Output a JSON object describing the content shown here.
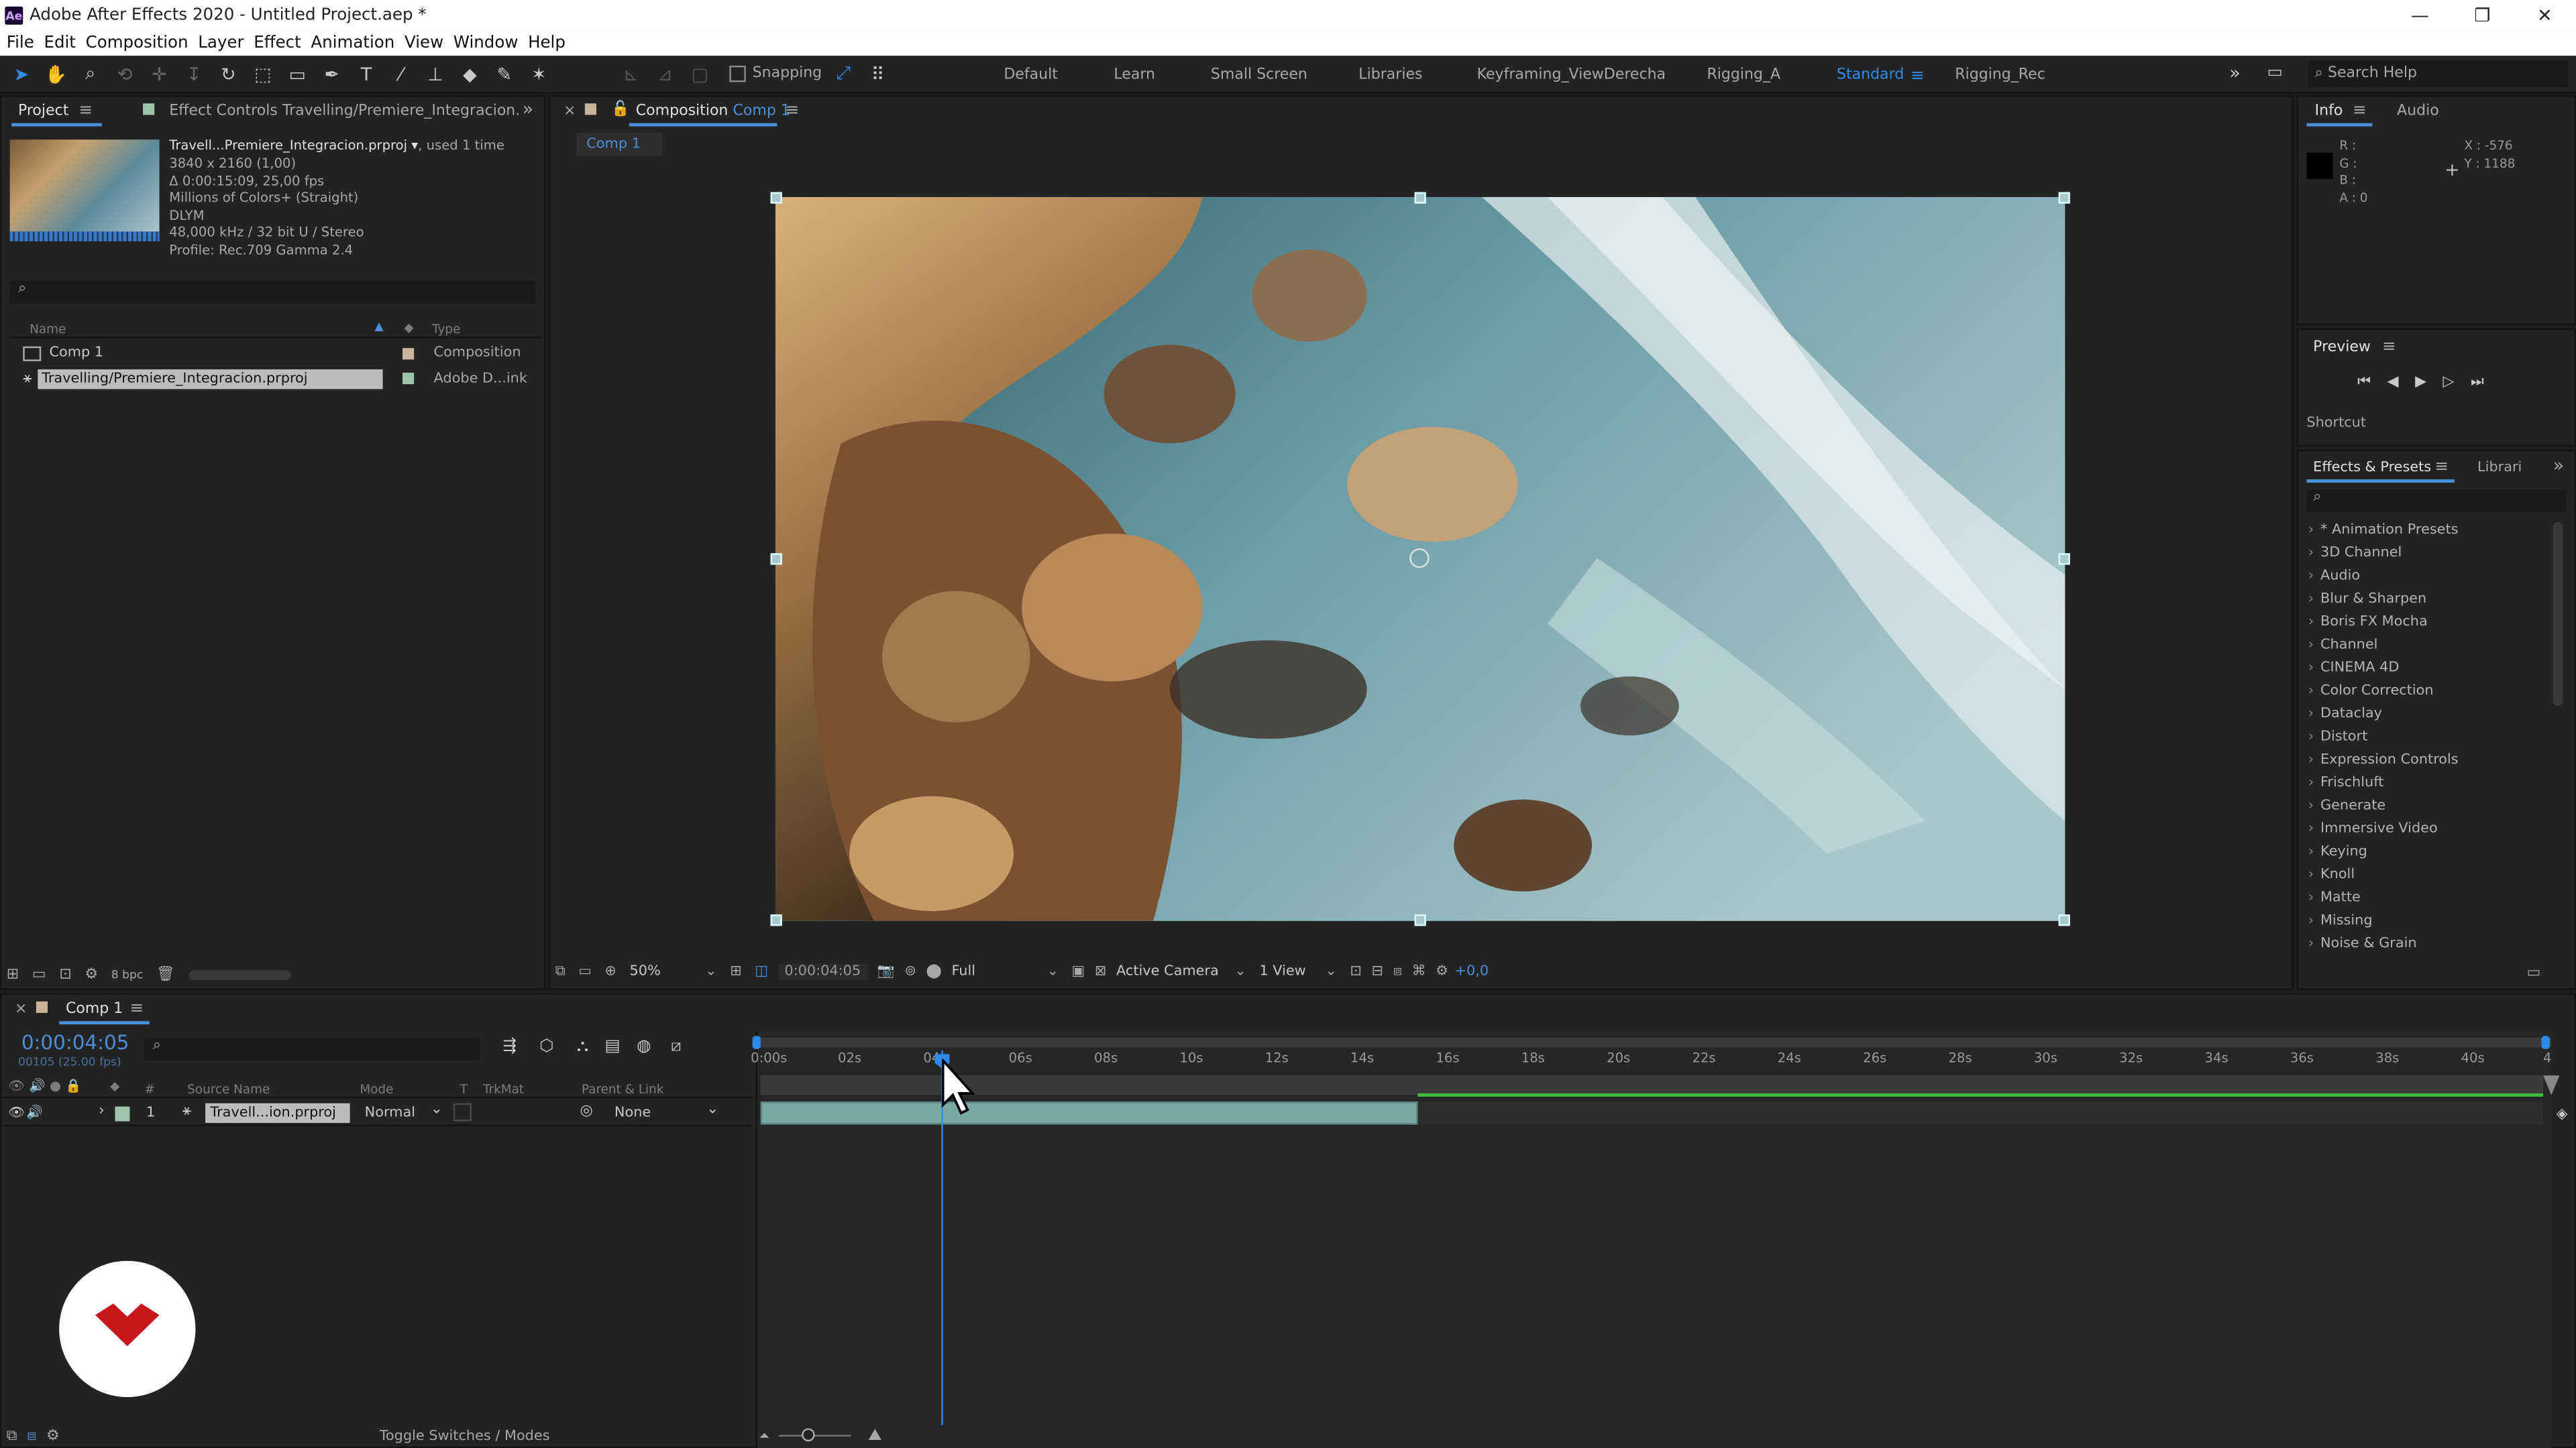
{
  "app": {
    "title": "Adobe After Effects 2020 - Untitled Project.aep *",
    "icon_text": "Ae"
  },
  "window_controls": [
    "—",
    "❐",
    "✕"
  ],
  "menu": [
    "File",
    "Edit",
    "Composition",
    "Layer",
    "Effect",
    "Animation",
    "View",
    "Window",
    "Help"
  ],
  "toolbar": {
    "snapping": "Snapping"
  },
  "workspaces": [
    "Default",
    "Learn",
    "Small Screen",
    "Libraries",
    "Keyframing_ViewDerecha",
    "Rigging_A",
    "Standard",
    "Rigging_Rec"
  ],
  "active_workspace": "Standard",
  "search_help": "Search Help",
  "project": {
    "tab": "Project",
    "effect_controls": "Effect Controls Travelling/Premiere_Integracion.",
    "item_title": "Travell...Premiere_Integracion.prproj ▾",
    "used": ", used 1 time",
    "info_lines": [
      "3840 x 2160 (1,00)",
      "Δ 0:00:15:09, 25,00 fps",
      "Millions of Colors+ (Straight)",
      "DLYM",
      "48,000 kHz / 32 bit U / Stereo",
      "Profile: Rec.709 Gamma 2.4"
    ],
    "columns": [
      "Name",
      "Type"
    ],
    "items": [
      {
        "name": "Comp 1",
        "type": "Composition"
      },
      {
        "name": "Travelling/Premiere_Integracion.prproj",
        "type": "Adobe D...ink"
      }
    ],
    "bpc": "8 bpc"
  },
  "composition": {
    "tab_label": "Composition",
    "tab_comp": "Comp 1",
    "breadcrumb": "Comp 1",
    "zoom": "50%",
    "timecode": "0:00:04:05",
    "resolution": "Full",
    "camera": "Active Camera",
    "view": "1 View",
    "exposure": "+0,0"
  },
  "info_panel": {
    "tab": "Info",
    "audio_tab": "Audio",
    "r": "R :",
    "g": "G :",
    "b": "B :",
    "a": "A :  0",
    "x": "X : -576",
    "y": "Y : 1188"
  },
  "preview": {
    "title": "Preview",
    "shortcut": "Shortcut"
  },
  "effects": {
    "tab": "Effects & Presets",
    "lib_tab": "Librari",
    "items": [
      "* Animation Presets",
      "3D Channel",
      "Audio",
      "Blur & Sharpen",
      "Boris FX Mocha",
      "Channel",
      "CINEMA 4D",
      "Color Correction",
      "Dataclay",
      "Distort",
      "Expression Controls",
      "Frischluft",
      "Generate",
      "Immersive Video",
      "Keying",
      "Knoll",
      "Matte",
      "Missing",
      "Noise & Grain"
    ]
  },
  "timeline": {
    "tab": "Comp 1",
    "timecode": "0:00:04:05",
    "sub": "00105 (25.00 fps)",
    "ticks": [
      "0:00s",
      "02s",
      "04s",
      "06s",
      "08s",
      "10s",
      "12s",
      "14s",
      "16s",
      "18s",
      "20s",
      "22s",
      "24s",
      "26s",
      "28s",
      "30s",
      "32s",
      "34s",
      "36s",
      "38s",
      "40s",
      "4"
    ],
    "columns": [
      "#",
      "Source Name",
      "Mode",
      "T",
      "TrkMat",
      "Parent & Link"
    ],
    "layer": {
      "num": "1",
      "name": "Travell...ion.prproj",
      "mode": "Normal",
      "parent": "None"
    },
    "toggle": "Toggle Switches / Modes"
  },
  "colors": {
    "accent": "#2d8ceb",
    "layer_bar": "#79a8a6",
    "work_area": "#3cbd3c"
  }
}
